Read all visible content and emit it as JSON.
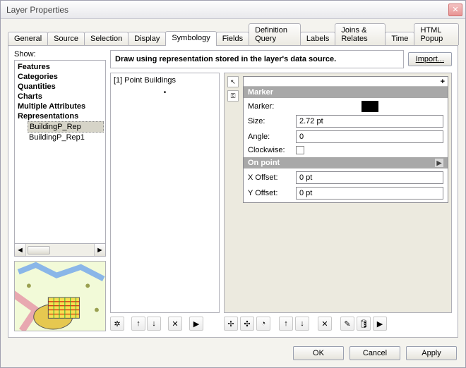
{
  "title": "Layer Properties",
  "tabs": [
    "General",
    "Source",
    "Selection",
    "Display",
    "Symbology",
    "Fields",
    "Definition Query",
    "Labels",
    "Joins & Relates",
    "Time",
    "HTML Popup"
  ],
  "activeTab": "Symbology",
  "showLabel": "Show:",
  "tree": {
    "items": [
      "Features",
      "Categories",
      "Quantities",
      "Charts",
      "Multiple Attributes",
      "Representations"
    ],
    "reps": [
      "BuildingP_Rep",
      "BuildingP_Rep1"
    ],
    "selected": "BuildingP_Rep"
  },
  "drawText": "Draw using representation stored in the layer's data source.",
  "importLabel": "Import...",
  "repList": {
    "title": "[1] Point Buildings"
  },
  "marker": {
    "header": "Marker",
    "markerLabel": "Marker:",
    "sizeLabel": "Size:",
    "sizeValue": "2.72 pt",
    "angleLabel": "Angle:",
    "angleValue": "0",
    "clockwiseLabel": "Clockwise:",
    "onPointHeader": "On point",
    "xOffsetLabel": "X Offset:",
    "xOffsetValue": "0 pt",
    "yOffsetLabel": "Y Offset:",
    "yOffsetValue": "0 pt"
  },
  "buttons": {
    "ok": "OK",
    "cancel": "Cancel",
    "apply": "Apply"
  }
}
